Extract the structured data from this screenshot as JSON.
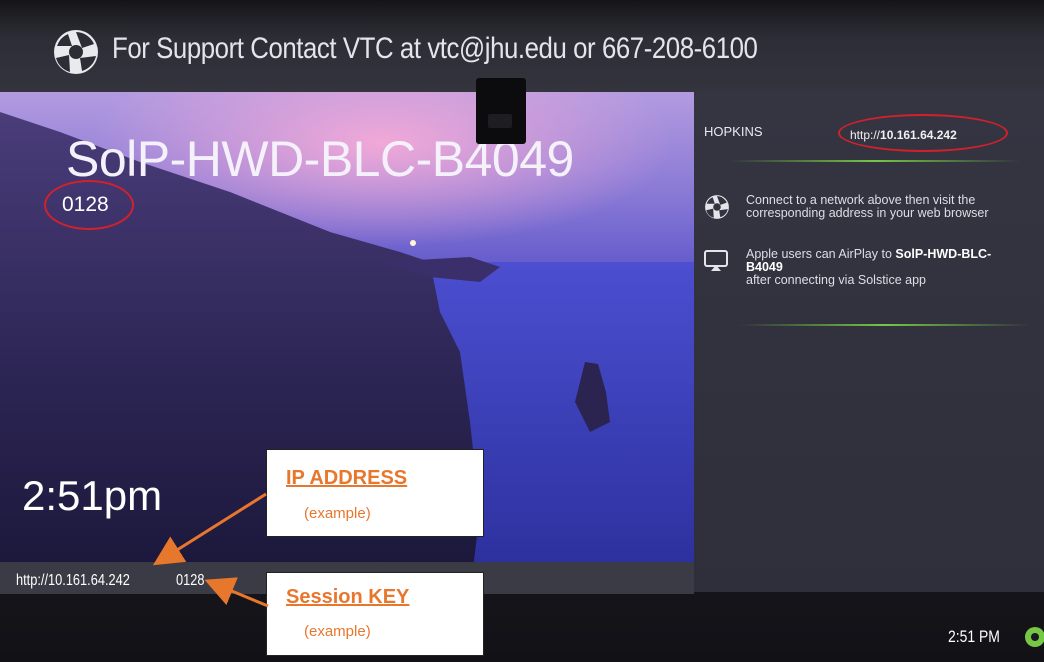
{
  "header": {
    "support_text": "For Support Contact VTC at vtc@jhu.edu or 667-208-6100",
    "logo_icon": "solstice-aperture-icon"
  },
  "display": {
    "room_name": "SolP-HWD-BLC-B4049",
    "session_key": "0128",
    "time_large": "2:51pm"
  },
  "panel": {
    "network_name": "HOPKINS",
    "network_url_prefix": "http://",
    "network_url_ip": "10.161.64.242",
    "instructions": [
      {
        "icon": "solstice-aperture-icon",
        "line1": "Connect to a network above then visit the",
        "line2": "corresponding address in your web browser"
      },
      {
        "icon": "airplay-icon",
        "line1_prefix": "Apple users can AirPlay to ",
        "line1_bold": "SolP-HWD-BLC-",
        "line2_bold": "B4049",
        "line3": "after connecting via Solstice app"
      }
    ]
  },
  "footer": {
    "url": "http://10.161.64.242",
    "session_key": "0128",
    "clock": "2:51 PM"
  },
  "callouts": {
    "ip": {
      "title": "IP ADDRESS",
      "sub": "(example)"
    },
    "key": {
      "title": "Session KEY",
      "sub": "(example)"
    }
  },
  "colors": {
    "accent_green": "#76c743",
    "annotation_red": "#d2212c",
    "callout_orange": "#e8772e"
  }
}
